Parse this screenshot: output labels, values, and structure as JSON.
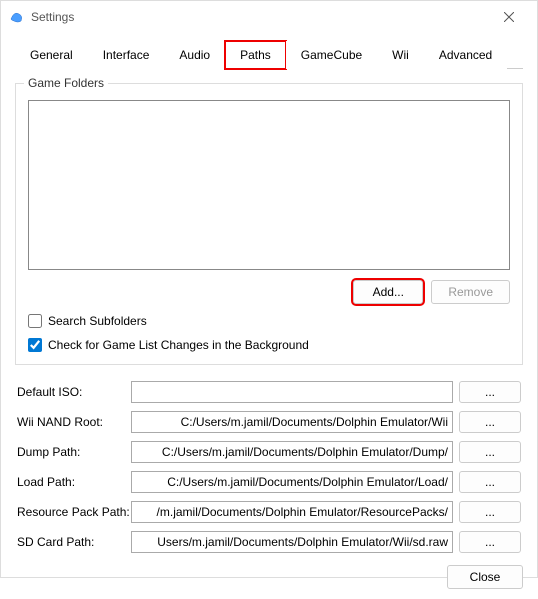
{
  "window": {
    "title": "Settings"
  },
  "tabs": [
    {
      "label": "General",
      "active": false
    },
    {
      "label": "Interface",
      "active": false
    },
    {
      "label": "Audio",
      "active": false
    },
    {
      "label": "Paths",
      "active": true,
      "highlight": true
    },
    {
      "label": "GameCube",
      "active": false
    },
    {
      "label": "Wii",
      "active": false
    },
    {
      "label": "Advanced",
      "active": false
    }
  ],
  "game_folders": {
    "title": "Game Folders",
    "items": [],
    "add_label": "Add...",
    "add_highlight": true,
    "remove_label": "Remove",
    "remove_enabled": false,
    "search_subfolders": {
      "label": "Search Subfolders",
      "checked": false
    },
    "check_background": {
      "label": "Check for Game List Changes in the Background",
      "checked": true
    }
  },
  "paths": [
    {
      "label": "Default ISO:",
      "value": "",
      "name": "default-iso"
    },
    {
      "label": "Wii NAND Root:",
      "value": "C:/Users/m.jamil/Documents/Dolphin Emulator/Wii",
      "name": "wii-nand-root"
    },
    {
      "label": "Dump Path:",
      "value": "C:/Users/m.jamil/Documents/Dolphin Emulator/Dump/",
      "name": "dump-path"
    },
    {
      "label": "Load Path:",
      "value": "C:/Users/m.jamil/Documents/Dolphin Emulator/Load/",
      "name": "load-path"
    },
    {
      "label": "Resource Pack Path:",
      "value": "/m.jamil/Documents/Dolphin Emulator/ResourcePacks/",
      "name": "resource-pack-path"
    },
    {
      "label": "SD Card Path:",
      "value": "Users/m.jamil/Documents/Dolphin Emulator/Wii/sd.raw",
      "name": "sd-card-path"
    }
  ],
  "browse_label": "...",
  "footer": {
    "close_label": "Close"
  }
}
